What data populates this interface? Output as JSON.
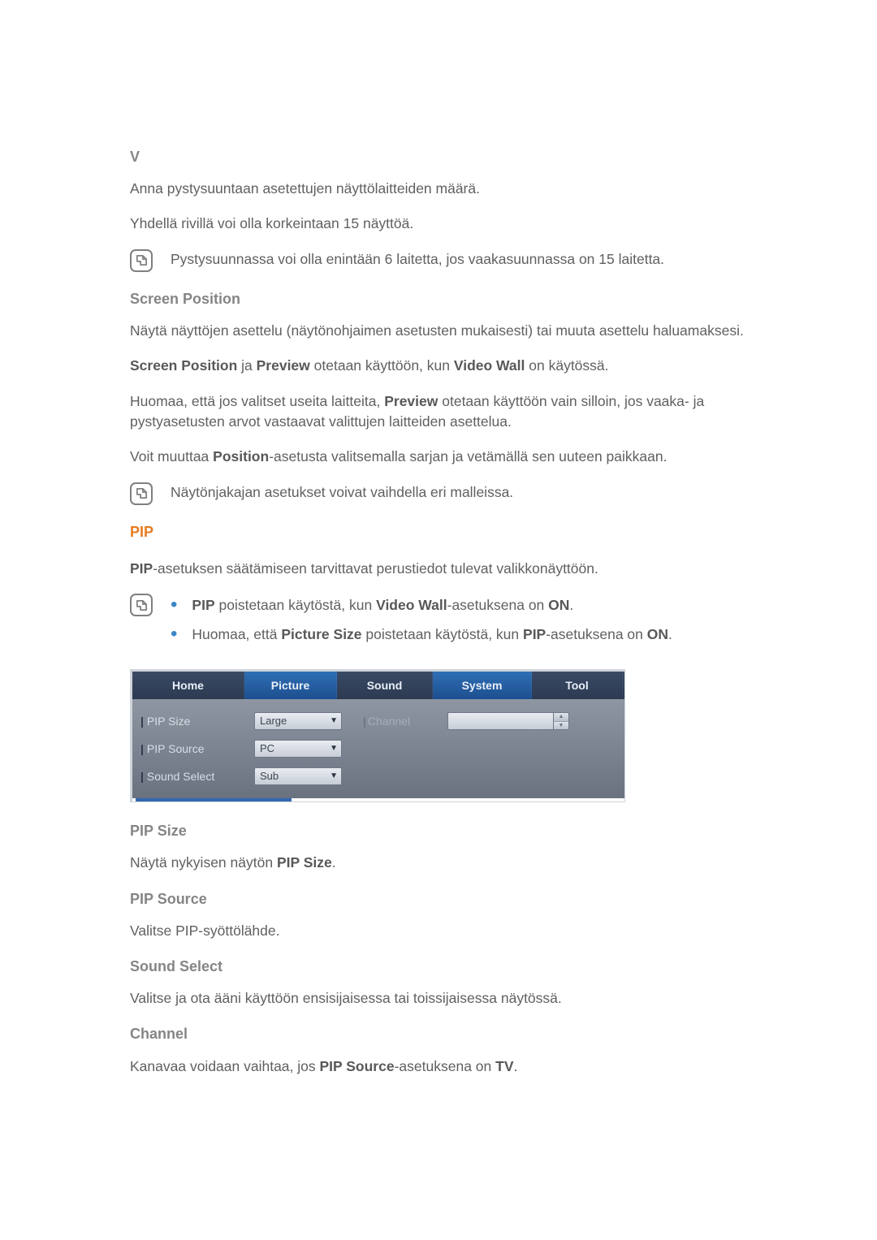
{
  "v_section": {
    "heading": "V",
    "p1": "Anna pystysuuntaan asetettujen näyttölaitteiden määrä.",
    "p2": "Yhdellä rivillä voi olla korkeintaan 15 näyttöä.",
    "note": "Pystysuunnassa voi olla enintään 6 laitetta, jos vaakasuunnassa on 15 laitetta."
  },
  "screen_position": {
    "heading": "Screen Position",
    "p1": "Näytä näyttöjen asettelu (näytönohjaimen asetusten mukaisesti) tai muuta asettelu haluamaksesi.",
    "p2a": "Screen Position",
    "p2b": " ja ",
    "p2c": "Preview",
    "p2d": " otetaan käyttöön, kun ",
    "p2e": "Video Wall",
    "p2f": " on käytössä.",
    "p3a": "Huomaa, että jos valitset useita laitteita, ",
    "p3b": "Preview",
    "p3c": " otetaan käyttöön vain silloin, jos vaaka- ja pystyasetusten arvot vastaavat valittujen laitteiden asettelua.",
    "p4a": "Voit muuttaa ",
    "p4b": "Position",
    "p4c": "-asetusta valitsemalla sarjan ja vetämällä sen uuteen paikkaan.",
    "note": "Näytönjakajan asetukset voivat vaihdella eri malleissa."
  },
  "pip": {
    "heading": "PIP",
    "p1a": "PIP",
    "p1b": "-asetuksen säätämiseen tarvittavat perustiedot tulevat valikkonäyttöön.",
    "bullets": [
      {
        "a": "PIP",
        "b": " poistetaan käytöstä, kun ",
        "c": "Video Wall",
        "d": "-asetuksena on ",
        "e": "ON",
        "f": "."
      },
      {
        "a": "Huomaa, että ",
        "b": "Picture Size",
        "c": " poistetaan käytöstä, kun ",
        "d": "PIP",
        "e": "-asetuksena on ",
        "f": "ON",
        "g": "."
      }
    ]
  },
  "panel": {
    "tabs": {
      "home": "Home",
      "picture": "Picture",
      "sound": "Sound",
      "system": "System",
      "tool": "Tool"
    },
    "rows": {
      "pip_size": {
        "label": "PIP Size",
        "value": "Large"
      },
      "pip_source": {
        "label": "PIP Source",
        "value": "PC"
      },
      "sound_select": {
        "label": "Sound Select",
        "value": "Sub"
      },
      "channel": {
        "label": "Channel"
      }
    }
  },
  "defs": {
    "pip_size": {
      "h": "PIP Size",
      "ta": "Näytä nykyisen näytön ",
      "tb": "PIP Size",
      "tc": "."
    },
    "pip_source": {
      "h": "PIP Source",
      "t": "Valitse PIP-syöttölähde."
    },
    "sound_select": {
      "h": "Sound Select",
      "t": "Valitse ja ota ääni käyttöön ensisijaisessa tai toissijaisessa näytössä."
    },
    "channel": {
      "h": "Channel",
      "ta": "Kanavaa voidaan vaihtaa, jos ",
      "tb": "PIP Source",
      "tc": "-asetuksena on ",
      "td": "TV",
      "te": "."
    }
  }
}
